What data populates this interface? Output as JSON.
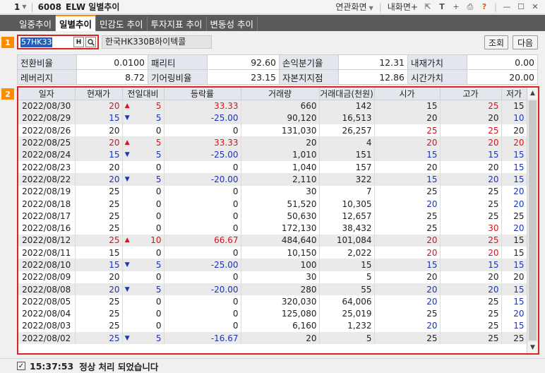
{
  "titlebar": {
    "window_number": "1",
    "code": "6008",
    "title": "ELW 일별추이",
    "linked_screen": "연관화면",
    "my_screen": "내화면+",
    "help": "?"
  },
  "tabs": [
    {
      "label": "일중추이",
      "active": false
    },
    {
      "label": "일별추이",
      "active": true
    },
    {
      "label": "민감도 추이",
      "active": false
    },
    {
      "label": "투자지표 추이",
      "active": false
    },
    {
      "label": "변동성 추이",
      "active": false
    }
  ],
  "markers": {
    "one": "1",
    "two": "2"
  },
  "search": {
    "code": "57HK33",
    "name": "한국HK330B하이텍콜",
    "h_label": "H",
    "query_button": "조회",
    "next_button": "다음"
  },
  "info": {
    "row1": [
      {
        "label": "전환비율",
        "value": "0.0100"
      },
      {
        "label": "패리티",
        "value": "92.60"
      },
      {
        "label": "손익분기율",
        "value": "12.31"
      },
      {
        "label": "내재가치",
        "value": "0.00"
      }
    ],
    "row2": [
      {
        "label": "레버리지",
        "value": "8.72"
      },
      {
        "label": "기어링비율",
        "value": "23.15"
      },
      {
        "label": "자본지지점",
        "value": "12.86"
      },
      {
        "label": "시간가치",
        "value": "20.00"
      }
    ]
  },
  "table": {
    "headers": [
      "일자",
      "현재가",
      "전일대비",
      "등락률",
      "거래량",
      "거래대금(천원)",
      "시가",
      "고가",
      "저가"
    ],
    "rows": [
      [
        "2022/08/30",
        "20",
        "up",
        "5",
        "33.33",
        "660",
        "142",
        "15",
        "25",
        "15"
      ],
      [
        "2022/08/29",
        "15",
        "down",
        "5",
        "-25.00",
        "90,120",
        "16,513",
        "20",
        "20",
        "10"
      ],
      [
        "2022/08/26",
        "20",
        "",
        "0",
        "0",
        "131,030",
        "26,257",
        "25",
        "25",
        "20"
      ],
      [
        "2022/08/25",
        "20",
        "up",
        "5",
        "33.33",
        "20",
        "4",
        "20",
        "20",
        "20"
      ],
      [
        "2022/08/24",
        "15",
        "down",
        "5",
        "-25.00",
        "1,010",
        "151",
        "15",
        "15",
        "15"
      ],
      [
        "2022/08/23",
        "20",
        "",
        "0",
        "0",
        "1,040",
        "157",
        "20",
        "20",
        "15"
      ],
      [
        "2022/08/22",
        "20",
        "down",
        "5",
        "-20.00",
        "2,110",
        "322",
        "15",
        "20",
        "15"
      ],
      [
        "2022/08/19",
        "25",
        "",
        "0",
        "0",
        "30",
        "7",
        "25",
        "25",
        "20"
      ],
      [
        "2022/08/18",
        "25",
        "",
        "0",
        "0",
        "51,520",
        "10,305",
        "20",
        "25",
        "20"
      ],
      [
        "2022/08/17",
        "25",
        "",
        "0",
        "0",
        "50,630",
        "12,657",
        "25",
        "25",
        "25"
      ],
      [
        "2022/08/16",
        "25",
        "",
        "0",
        "0",
        "172,130",
        "38,432",
        "25",
        "30",
        "20"
      ],
      [
        "2022/08/12",
        "25",
        "up",
        "10",
        "66.67",
        "484,640",
        "101,084",
        "20",
        "25",
        "15"
      ],
      [
        "2022/08/11",
        "15",
        "",
        "0",
        "0",
        "10,150",
        "2,022",
        "20",
        "20",
        "15"
      ],
      [
        "2022/08/10",
        "15",
        "down",
        "5",
        "-25.00",
        "100",
        "15",
        "15",
        "15",
        "15"
      ],
      [
        "2022/08/09",
        "20",
        "",
        "0",
        "0",
        "30",
        "5",
        "20",
        "20",
        "20"
      ],
      [
        "2022/08/08",
        "20",
        "down",
        "5",
        "-20.00",
        "280",
        "55",
        "20",
        "20",
        "15"
      ],
      [
        "2022/08/05",
        "25",
        "",
        "0",
        "0",
        "320,030",
        "64,006",
        "20",
        "25",
        "15"
      ],
      [
        "2022/08/04",
        "25",
        "",
        "0",
        "0",
        "125,080",
        "25,019",
        "25",
        "25",
        "20"
      ],
      [
        "2022/08/03",
        "25",
        "",
        "0",
        "0",
        "6,160",
        "1,232",
        "20",
        "25",
        "15"
      ],
      [
        "2022/08/02",
        "25",
        "down",
        "5",
        "-16.67",
        "20",
        "5",
        "25",
        "25",
        "25"
      ]
    ]
  },
  "status": {
    "time": "15:37:53",
    "message": "정상 처리 되었습니다"
  },
  "colors": {
    "up": "#d6131c",
    "down": "#1a35b8",
    "accent": "#ff8c00",
    "highlight": "#dd2222"
  }
}
